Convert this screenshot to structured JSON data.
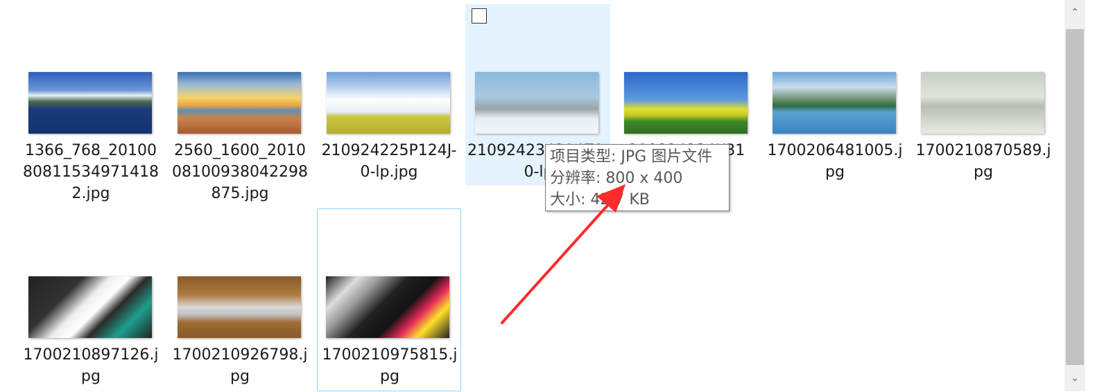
{
  "files": [
    {
      "name": "1366_768_20100808115349714182.jpg"
    },
    {
      "name": "2560_1600_20100810093804229 8875.jpg"
    },
    {
      "name": "210924225P124J-0-lp.jpg"
    },
    {
      "name": "210924234214Z1-0-lp.jpg"
    },
    {
      "name": "210924234K31"
    },
    {
      "name": "1700206481005.jpg"
    },
    {
      "name": "1700210870589.jpg"
    },
    {
      "name": "1700210897126.jpg"
    },
    {
      "name": "1700210926798.jpg"
    },
    {
      "name": "1700210975815.jpg"
    }
  ],
  "labels": {
    "f1": "1366_768_20100808115349714182.jpg",
    "f2": "2560_1600_20100810093804229 8875.jpg",
    "f3": "210924225P124J-0-lp.jpg",
    "f4": "21092423 4214 Z1-0-lp",
    "f5": "21092423 4K31",
    "f6": "1700206481005.jpg",
    "f7": "1700210870589.jpg",
    "f8": "1700210897126.jpg",
    "f9": "1700210926798.jpg",
    "f10": "1700210975815.jpg"
  },
  "tooltip": {
    "type": "项目类型: JPG 图片文件",
    "resolution": "分辨率: 800 x 400",
    "size": "大小: 42.7 KB"
  },
  "colors": {
    "hover_bg": "#e5f3ff",
    "focus_border": "#99d1ff",
    "annotation_arrow": "#ff2a2a"
  },
  "icons": {
    "scroll_up": "chevron-up-icon",
    "scroll_down": "chevron-down-icon"
  }
}
